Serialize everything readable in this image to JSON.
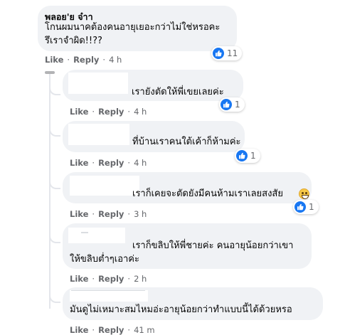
{
  "colors": {
    "bubble_bg": "#f0f2f5",
    "meta_text": "#65676b",
    "like_blue": "#1877f2",
    "thread_line": "#e4e6eb"
  },
  "icons": [
    "like-thumb-icon",
    "haha-emoji-icon"
  ],
  "main_comment": {
    "author": "พลอย'ย จ๋าา",
    "text": "โกนผมนาคต้องคนอายุเยอะกว่าไม่ใช่หรอคะ\nรึเราจำผิด!!??",
    "like_label": "Like",
    "reply_label": "Reply",
    "time": "4 h",
    "reaction_count": "11"
  },
  "replies": [
    {
      "text": "เรายังตัดให้พี่เขยเลยค่ะ",
      "like_label": "Like",
      "reply_label": "Reply",
      "time": "4 h",
      "reaction_count": "1"
    },
    {
      "text": "ที่บ้านเราคนใต้เค้าก็ห้ามค่ะ",
      "like_label": "Like",
      "reply_label": "Reply",
      "time": "4 h",
      "reaction_count": "1"
    },
    {
      "text": "เราก็เคยจะตัดยังมีคนห้ามเราเลยสงสัย",
      "like_label": "Like",
      "reply_label": "Reply",
      "time": "3 h",
      "reaction_count": "1"
    },
    {
      "text": "เราก็ขลิบให้พี่ชายค่ะ คนอายุน้อยกว่าเขา\nให้ขลิบต่ำๆเอาค่ะ",
      "like_label": "Like",
      "reply_label": "Reply",
      "time": "2 h"
    },
    {
      "text": "มันดูไม่เหมาะสมไหมอ่ะอายุน้อยกว่าทำแบบนี้ได้ด้วยหรอ",
      "like_label": "Like",
      "reply_label": "Reply",
      "time": "41 m"
    }
  ]
}
